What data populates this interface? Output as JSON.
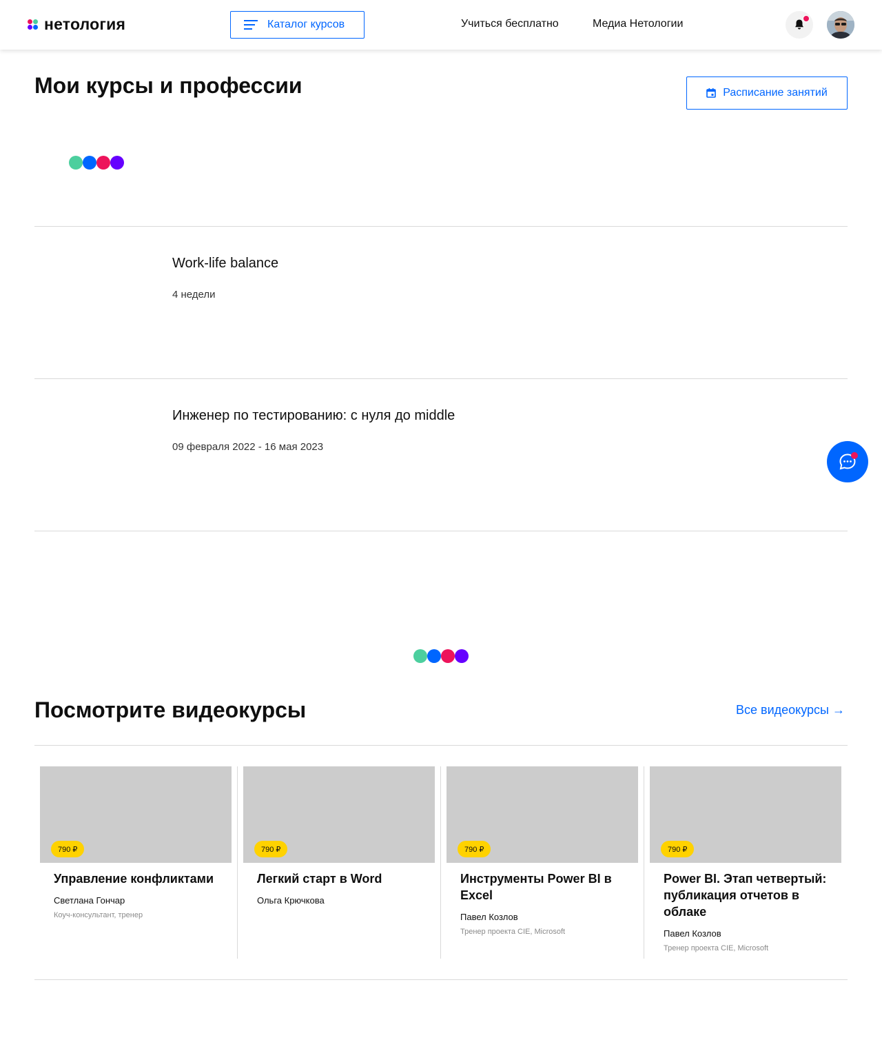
{
  "header": {
    "logo_text": "нетология",
    "catalog_label": "Каталог курсов",
    "nav": [
      "Учиться бесплатно",
      "Медиа Нетологии"
    ]
  },
  "main": {
    "title": "Мои курсы и профессии",
    "schedule_label": "Расписание занятий",
    "courses": [
      {
        "title": "Work-life balance",
        "meta": "4 недели"
      },
      {
        "title": "Инженер по тестированию: с нуля до middle",
        "meta": "09 февраля 2022 - 16 мая 2023"
      }
    ]
  },
  "videocourses": {
    "title": "Посмотрите видеокурсы",
    "all_link": "Все видеокурсы →",
    "cards": [
      {
        "price": "790 ₽",
        "title": "Управление конфликтами",
        "author": "Светлана Гончар",
        "role": "Коуч-консультант, тренер"
      },
      {
        "price": "790 ₽",
        "title": "Легкий старт в Word",
        "author": "Ольга Крючкова",
        "role": ""
      },
      {
        "price": "790 ₽",
        "title": "Инструменты Power BI в Excel",
        "author": "Павел Козлов",
        "role": "Тренер проекта CIE, Microsoft"
      },
      {
        "price": "790 ₽",
        "title": "Power BI. Этап четвертый: публикация отчетов в облаке",
        "author": "Павел Козлов",
        "role": "Тренер проекта CIE, Microsoft"
      }
    ]
  },
  "colors": {
    "accent": "#0066ff",
    "loader": [
      "#4ccf9e",
      "#0066ff",
      "#ed145b",
      "#6600ff"
    ],
    "price_badge": "#ffd200",
    "notification": "#ed145b"
  },
  "icons": [
    "burger-menu-icon",
    "bell-icon",
    "calendar-icon",
    "chat-icon",
    "arrow-right-icon"
  ]
}
